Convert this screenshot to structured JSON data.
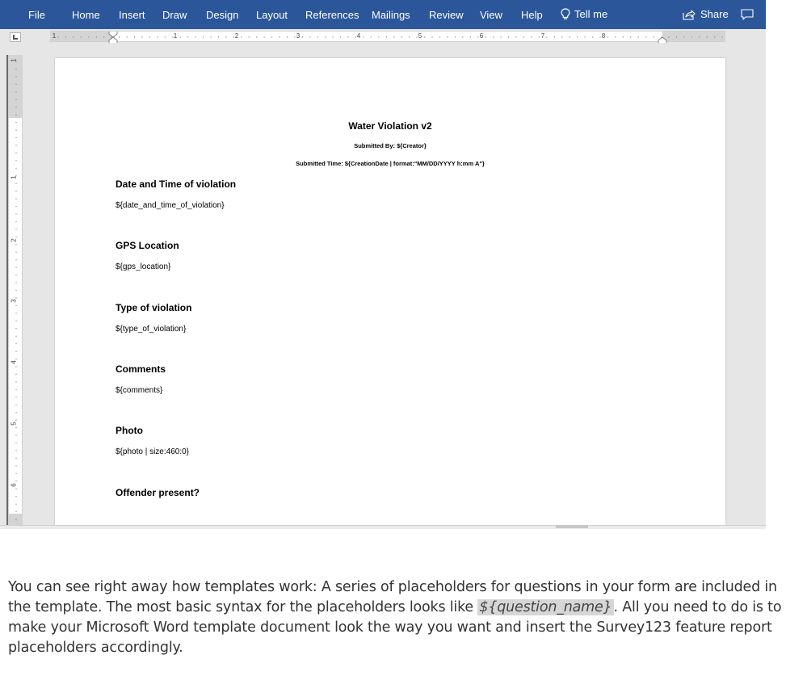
{
  "ribbon": {
    "tabs": [
      "File",
      "Home",
      "Insert",
      "Draw",
      "Design",
      "Layout",
      "References",
      "Mailings",
      "Review",
      "View",
      "Help"
    ],
    "tell_me": "Tell me",
    "share": "Share"
  },
  "icons": {
    "tell_me": "lightbulb-icon",
    "share": "share-icon",
    "comment": "comment-icon"
  },
  "colors": {
    "ribbon": "#2b579a",
    "workspace": "#e6e6e6",
    "highlight": "#d6d6d6"
  },
  "ruler": {
    "horizontal_numbers": [
      "1",
      "1",
      "2",
      "3",
      "4",
      "5",
      "6",
      "7",
      "8"
    ],
    "vertical_numbers": [
      "1",
      "1",
      "2",
      "3",
      "4",
      "5",
      "6"
    ]
  },
  "document": {
    "title": "Water Violation v2",
    "submitted_by": "Submitted By: ${Creator}",
    "submitted_time": "Submitted Time: ${CreationDate | format:\"MM/DD/YYYY h:mm A\"}",
    "fields": [
      {
        "heading": "Date and Time of violation",
        "placeholder": "${date_and_time_of_violation}"
      },
      {
        "heading": "GPS Location",
        "placeholder": "${gps_location}"
      },
      {
        "heading": "Type of violation",
        "placeholder": "${type_of_violation}"
      },
      {
        "heading": "Comments",
        "placeholder": "${comments}"
      },
      {
        "heading": "Photo",
        "placeholder": "${photo | size:460:0}"
      },
      {
        "heading": "Offender present?",
        "placeholder": ""
      }
    ]
  },
  "article": {
    "text_before": "You can see right away how templates work: A series of placeholders for questions in your form are included in the template. The most basic syntax for the placeholders looks like ",
    "code": "${question_name}",
    "text_after": ". All you need to do is to make your Microsoft Word template document look the way you want and insert the Survey123 feature report placeholders accordingly."
  }
}
